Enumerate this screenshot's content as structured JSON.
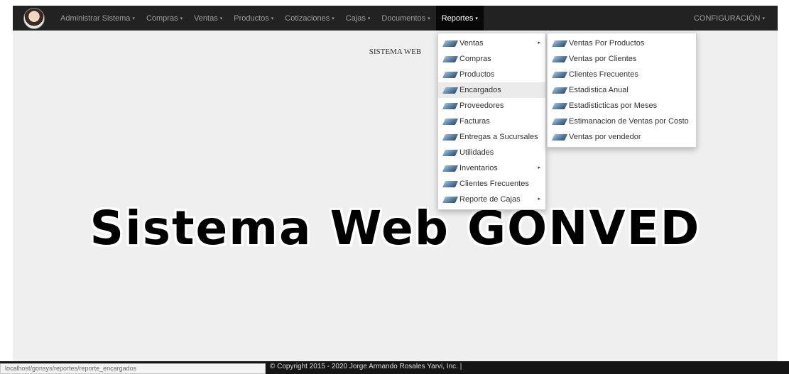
{
  "navbar": {
    "items": [
      {
        "label": "Administrar Sistema"
      },
      {
        "label": "Compras"
      },
      {
        "label": "Ventas"
      },
      {
        "label": "Productos"
      },
      {
        "label": "Cotizaciones"
      },
      {
        "label": "Cajas"
      },
      {
        "label": "Documentos"
      },
      {
        "label": "Reportes"
      }
    ],
    "caret": "▾",
    "right_label": "CONFIGURACIÓN"
  },
  "main": {
    "small_title": "SISTEMA WEB",
    "big_title": "Sistema Web GONVED"
  },
  "reportes_menu": {
    "items": [
      {
        "label": "Ventas",
        "submenu": true
      },
      {
        "label": "Compras"
      },
      {
        "label": "Productos"
      },
      {
        "label": "Encargados",
        "highlighted": true
      },
      {
        "label": "Proveedores"
      },
      {
        "label": "Facturas"
      },
      {
        "label": "Entregas a Sucursales"
      },
      {
        "label": "Utilidades"
      },
      {
        "label": "Inventarios",
        "submenu": true
      },
      {
        "label": "Clientes Frecuentes"
      },
      {
        "label": "Reporte de Cajas",
        "submenu": true
      }
    ],
    "submenu_arrow": "▸"
  },
  "ventas_submenu": {
    "items": [
      {
        "label": "Ventas Por Productos"
      },
      {
        "label": "Ventas por Clientes"
      },
      {
        "label": "Clientes Frecuentes"
      },
      {
        "label": "Estadistica Anual"
      },
      {
        "label": "Estadisticticas por Meses"
      },
      {
        "label": "Estimanacion de Ventas por Costo"
      },
      {
        "label": "Ventas por vendedor"
      }
    ]
  },
  "footer": {
    "copyright": "© Copyright 2015 - 2020 Jorge Armando Rosales Yarvi, Inc. |"
  },
  "status_bar": {
    "url": "localhost/gonsys/reportes/reporte_encargados"
  },
  "colors": {
    "navbar_bg": "#222222",
    "nav_text": "#9d9d9d",
    "active_text": "#ffffff",
    "page_bg": "#efefef"
  },
  "icons": {
    "menu_item_icon": "book-icon"
  }
}
